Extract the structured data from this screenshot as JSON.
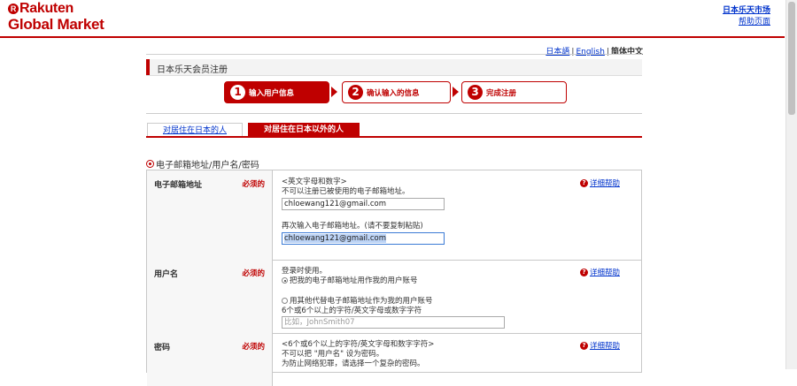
{
  "logo": {
    "line1": "Rakuten",
    "line2": "Global Market",
    "mark": "R"
  },
  "top_links": {
    "market": "日本乐天市场",
    "help": "帮助页面"
  },
  "languages": {
    "ja": "日本語",
    "en": "English",
    "sep": "|",
    "zh": "简体中文"
  },
  "page_title": "日本乐天会员注册",
  "steps": [
    {
      "num": "1",
      "label": "输入用户信息"
    },
    {
      "num": "2",
      "label": "确认输入的信息"
    },
    {
      "num": "3",
      "label": "完成注册"
    }
  ],
  "tabs": {
    "japan": "对居住在日本的人",
    "overseas": "对居住在日本以外的人"
  },
  "section_title": "电子邮箱地址/用户名/密码",
  "required_label": "必须的",
  "help_label": "详细帮助",
  "email": {
    "label": "电子邮箱地址",
    "hint1": "<英文字母和数字>",
    "hint2": "不可以注册已被使用的电子邮箱地址。",
    "value": "chloewang121@gmail.com",
    "confirm_hint": "再次输入电子邮箱地址。(请不要复制粘贴)",
    "confirm_value": "chloewang121@gmail.com"
  },
  "username": {
    "label": "用户名",
    "hint": "登录时使用。",
    "option1": "把我的电子邮箱地址用作我的用户账号",
    "option2": "用其他代替电子邮箱地址作为我的用户账号",
    "rule": "6个或6个以上的字符/英文字母或数字字符",
    "placeholder": "比如，JohnSmith07"
  },
  "password": {
    "label": "密码",
    "hint1": "<6个或6个以上的字符/英文字母和数字字符>",
    "hint2": "不可以把 \"用户名\" 设为密码。",
    "hint3": "为防止网络犯罪，请选择一个复杂的密码。"
  },
  "colors": {
    "brand_red": "#bf0000",
    "link_blue": "#0033cc"
  }
}
